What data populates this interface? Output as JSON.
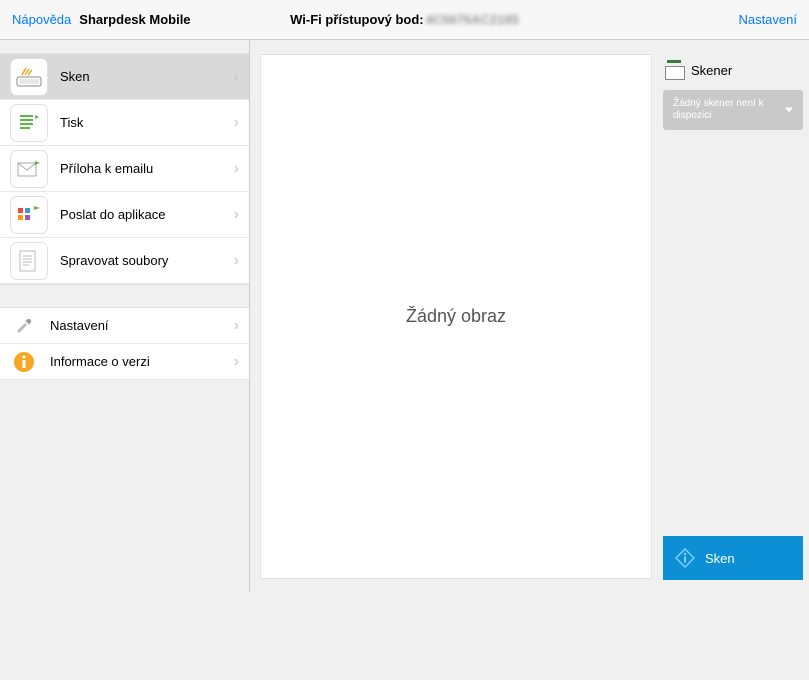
{
  "topbar": {
    "help": "Nápověda",
    "title": "Sharpdesk Mobile",
    "wifi_label": "Wi-Fi přístupový bod:",
    "wifi_ssid": "4C5676AC2185",
    "settings": "Nastavení"
  },
  "sidebar": {
    "items": [
      {
        "label": "Sken"
      },
      {
        "label": "Tisk"
      },
      {
        "label": "Příloha k emailu"
      },
      {
        "label": "Poslat do aplikace"
      },
      {
        "label": "Spravovat soubory"
      }
    ],
    "secondary": [
      {
        "label": "Nastavení"
      },
      {
        "label": "Informace o verzi"
      }
    ]
  },
  "preview": {
    "empty_text": "Žádný obraz"
  },
  "scanner": {
    "header": "Skener",
    "dropdown_text": "Žádný skener není k dispozici"
  },
  "action": {
    "scan": "Sken"
  }
}
